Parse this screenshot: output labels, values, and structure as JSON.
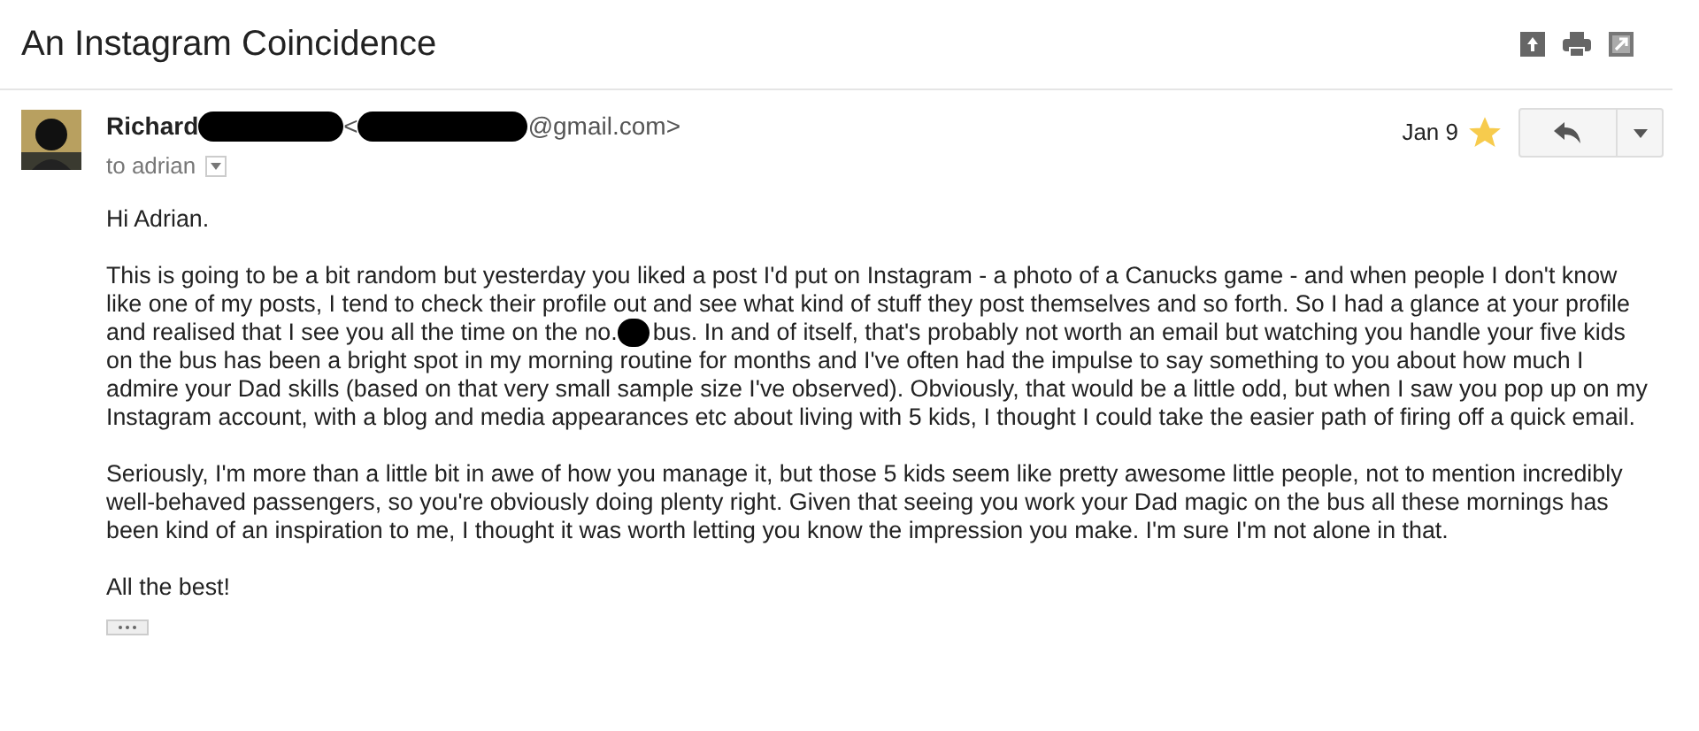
{
  "subject": "An Instagram Coincidence",
  "sender": {
    "name": "Richard",
    "name_redacted": true,
    "email_open": "<",
    "email_redacted": true,
    "email_domain": "@gmail.com>"
  },
  "recipient": "to adrian",
  "date": "Jan 9",
  "starred": true,
  "greeting": "Hi Adrian.",
  "paragraphs": [
    {
      "parts": [
        "This is going to be a bit random but yesterday you liked a post I'd put on Instagram - a photo of a Canucks game - and when people I don't know like one of my posts, I tend to check their profile out and see what kind of stuff they post themselves and so forth. So I had a glance at your profile and realised that I see you all the time on the no.",
        "bus. In and of itself, that's probably not worth an email but watching you handle your five kids on the bus has been a bright spot in my morning routine for months and I've often had the impulse to say something to you about how much I admire your Dad skills (based on that very small sample size I've observed). Obviously, that would be a little odd, but when I saw you pop up on my Instagram account, with a blog and media appearances etc about living with 5 kids, I thought I could take the easier path of firing off a quick email."
      ]
    },
    {
      "parts": [
        "Seriously, I'm more than a little bit in awe of how you manage it, but those 5 kids seem like pretty awesome little people, not to mention incredibly well-behaved passengers, so you're obviously doing plenty right. Given that seeing you work your Dad magic on the bus all these mornings has been kind of an inspiration to me, I thought it was worth letting you know the impression you make. I'm sure I'm not alone in that."
      ]
    }
  ],
  "signoff": "All the best!"
}
